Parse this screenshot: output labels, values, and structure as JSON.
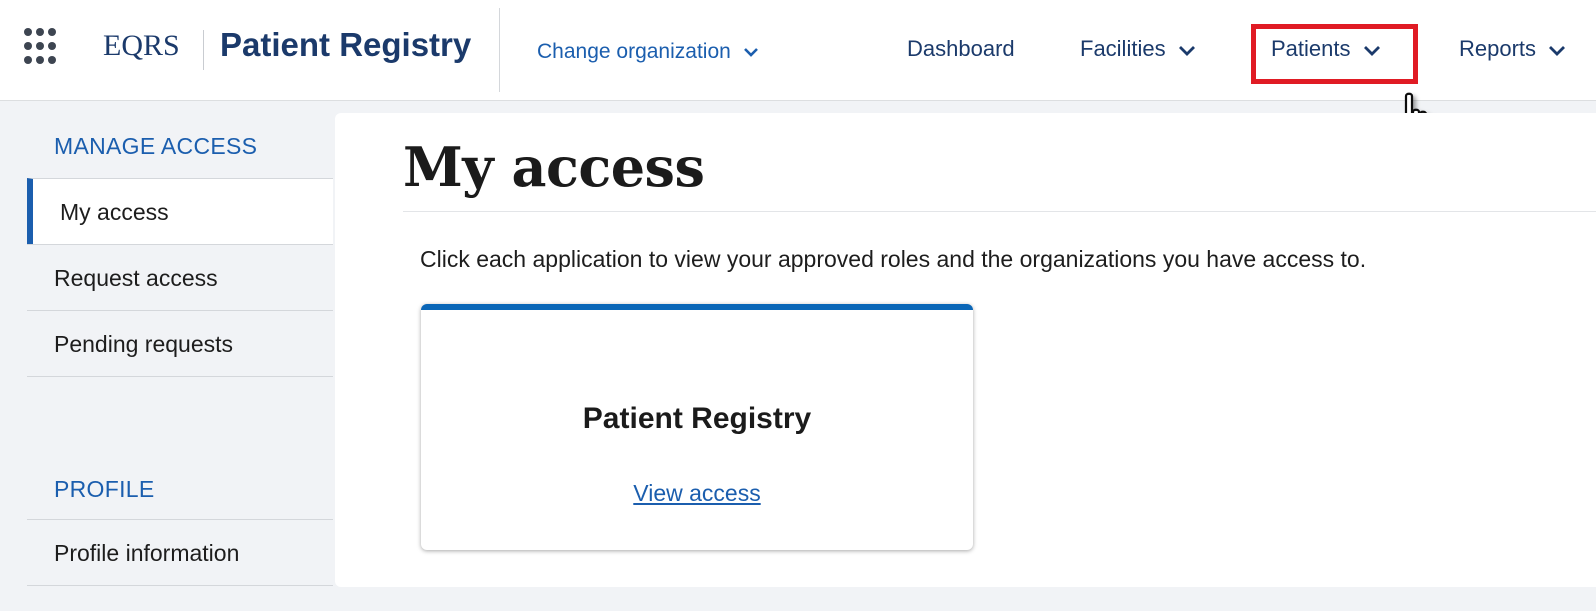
{
  "header": {
    "brand_short": "EQRS",
    "product_name": "Patient Registry",
    "change_org_label": "Change organization",
    "nav": [
      {
        "label": "Dashboard"
      },
      {
        "label": "Facilities"
      },
      {
        "label": "Patients",
        "highlighted": true
      },
      {
        "label": "Reports"
      }
    ]
  },
  "sidebar": {
    "manage_heading": "MANAGE ACCESS",
    "manage_items": [
      {
        "label": "My access",
        "active": true
      },
      {
        "label": "Request access"
      },
      {
        "label": "Pending requests"
      }
    ],
    "profile_heading": "PROFILE",
    "profile_items": [
      {
        "label": "Profile information"
      }
    ]
  },
  "main": {
    "title": "My access",
    "intro": "Click each application to view your approved roles and the organizations you have access to.",
    "card": {
      "title": "Patient Registry",
      "link_label": "View access"
    }
  },
  "icons": {
    "app_launcher": "grid-icon",
    "dropdown": "chevron-down-icon",
    "pointer": "hand-cursor-icon"
  },
  "colors": {
    "brand_navy": "#1b3a6b",
    "link_blue": "#1b5eae",
    "card_accent": "#0a66b7",
    "highlight_red": "#e01b24"
  }
}
